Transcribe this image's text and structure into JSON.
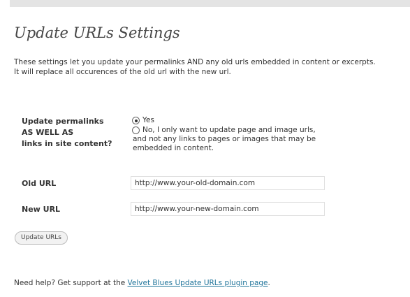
{
  "page": {
    "title": "Update URLs Settings",
    "description_line1": "These settings let you update your permalinks AND any old urls embedded in content or excerpts.",
    "description_line2": "It will replace all occurences of the old url with the new url."
  },
  "permalink_option": {
    "label_line1": "Update permalinks",
    "label_line2": "AS WELL AS",
    "label_line3": "links in site content?",
    "options": [
      {
        "label": "Yes",
        "selected": true
      },
      {
        "label_lines": [
          "No, I only want to update page and image urls,",
          "and not any links to pages or images that may be",
          "embedded in content."
        ],
        "selected": false
      }
    ]
  },
  "fields": {
    "old_url_label": "Old URL",
    "old_url_value": "http://www.your-old-domain.com",
    "new_url_label": "New URL",
    "new_url_value": "http://www.your-new-domain.com"
  },
  "actions": {
    "update_button": "Update URLs"
  },
  "help": {
    "prefix": "Need help? Get support at the ",
    "link_text": "Velvet Blues Update URLs plugin page",
    "suffix": "."
  },
  "colors": {
    "link": "#21759b",
    "title": "#464646",
    "text": "#333333"
  }
}
